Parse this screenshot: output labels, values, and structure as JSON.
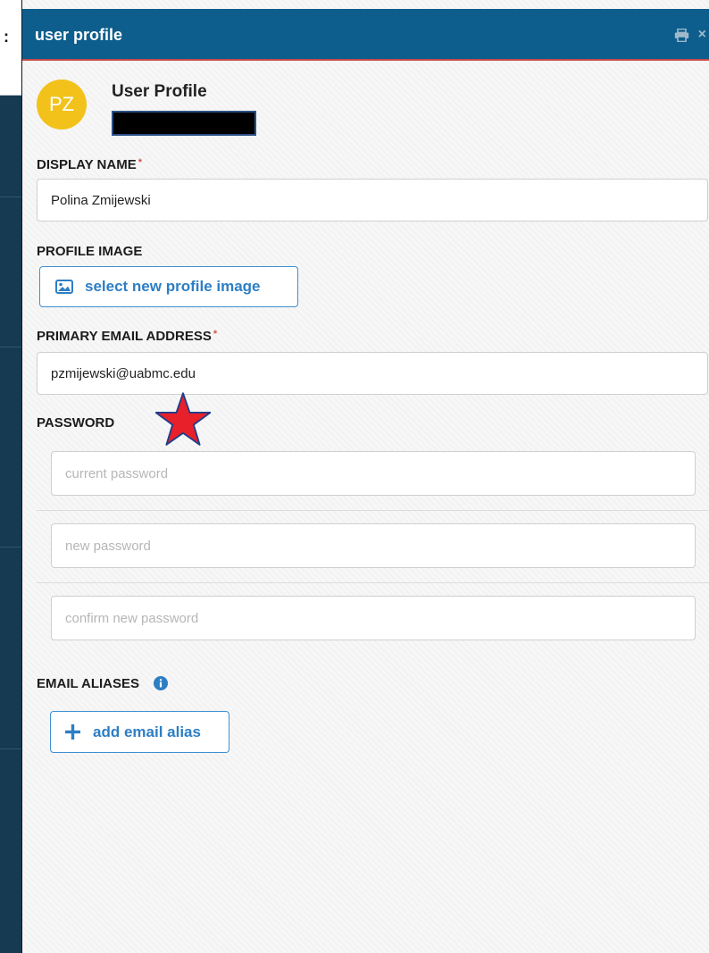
{
  "background": {
    "menu_glyph": ":"
  },
  "panel": {
    "title": "user profile",
    "icons": [
      "printer-icon",
      "close-icon"
    ],
    "close_glyph": "×"
  },
  "profile": {
    "initials": "PZ",
    "heading": "User Profile",
    "avatar_color": "#f2c21a"
  },
  "display_name": {
    "label": "DISPLAY NAME",
    "required_mark": "*",
    "value": "Polina Zmijewski"
  },
  "profile_image": {
    "label": "PROFILE IMAGE",
    "button_label": "select new profile image",
    "icon": "image-icon"
  },
  "primary_email": {
    "label": "PRIMARY EMAIL ADDRESS",
    "required_mark": "*",
    "value": "pzmijewski@uabmc.edu"
  },
  "password": {
    "label": "PASSWORD",
    "current_placeholder": "current password",
    "new_placeholder": "new password",
    "confirm_placeholder": "confirm new password"
  },
  "email_aliases": {
    "label": "EMAIL ALIASES",
    "info_icon": "info-icon",
    "button_label": "add email alias",
    "button_icon": "plus-icon"
  },
  "colors": {
    "header_bg": "#0d5e8c",
    "header_accent": "#c44a4a",
    "button_text": "#2d7ec4",
    "required": "#d9534f",
    "annotation_star": "#e8202a"
  }
}
